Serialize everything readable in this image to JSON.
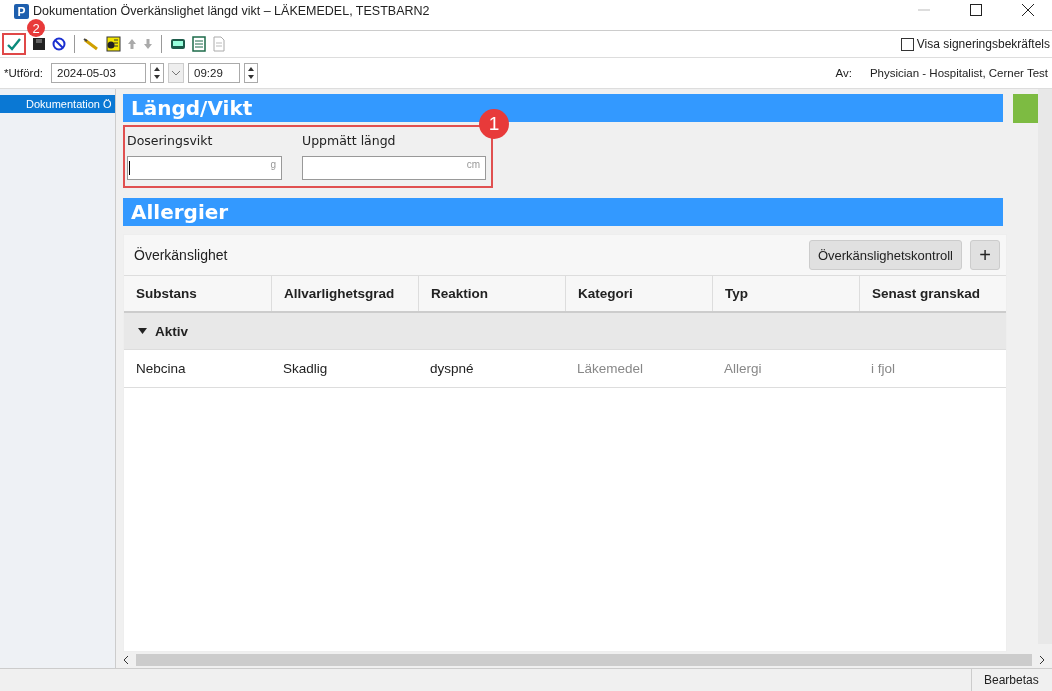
{
  "window": {
    "logo": "P",
    "title": "Dokumentation Överkänslighet längd vikt – LÄKEMEDEL, TESTBARN2"
  },
  "toolbar": {
    "checkbox": {
      "label": "Visa signeringsbekräftels",
      "checked": false
    }
  },
  "performed": {
    "label": "*Utförd:",
    "date": "2024-05-03",
    "time": "09:29",
    "by_label": "Av:",
    "by_value": "Physician - Hospitalist, Cerner Test"
  },
  "sidebar": {
    "items": [
      {
        "label": "Dokumentation Ö",
        "selected": true
      }
    ]
  },
  "sections": [
    {
      "title": "Längd/Vikt",
      "fields": [
        {
          "label": "Doseringsvikt",
          "unit": "g"
        },
        {
          "label": "Uppmätt längd",
          "unit": "cm"
        }
      ]
    },
    {
      "title": "Allergier"
    }
  ],
  "allergies": {
    "title": "Överkänslighet",
    "check_button": "Överkänslighetskontroll",
    "add_button": "+",
    "columns": [
      "Substans",
      "Allvarlighetsgrad",
      "Reaktion",
      "Kategori",
      "Typ",
      "Senast granskad"
    ],
    "groups": [
      {
        "label": "Aktiv",
        "expanded": true,
        "rows": [
          [
            {
              "text": "Nebcina",
              "muted": false
            },
            {
              "text": "Skadlig",
              "muted": false
            },
            {
              "text": "dyspné",
              "muted": false
            },
            {
              "text": "Läkemedel",
              "muted": true
            },
            {
              "text": "Allergi",
              "muted": true
            },
            {
              "text": "i fjol",
              "muted": true
            }
          ]
        ]
      }
    ]
  },
  "callouts": [
    "1",
    "2"
  ],
  "status_bar": {
    "text": "Bearbetas"
  }
}
